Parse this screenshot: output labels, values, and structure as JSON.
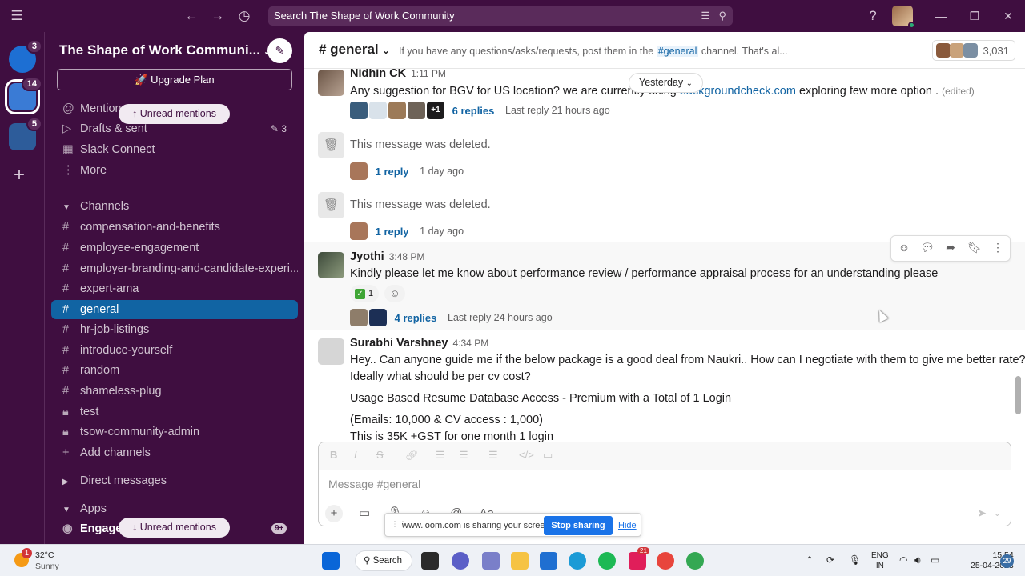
{
  "topbar": {
    "search_text": "Search The Shape of Work Community"
  },
  "rail": {
    "workspaces": [
      {
        "badge": "3",
        "color": "#1d6fd3"
      },
      {
        "badge": "14",
        "color": "#3a7bd5"
      },
      {
        "badge": "5",
        "color": "#3a6fb0"
      }
    ]
  },
  "sidebar": {
    "workspace_name": "The Shape of Work Communi...",
    "upgrade_label": "Upgrade Plan",
    "mentions_label": "Mentions",
    "unread_mentions_label": "Unread mentions",
    "drafts_label": "Drafts & sent",
    "drafts_count": "3",
    "slack_connect_label": "Slack Connect",
    "more_label": "More",
    "channels_header": "Channels",
    "channels": [
      {
        "name": "compensation-and-benefits",
        "icon": "#"
      },
      {
        "name": "employee-engagement",
        "icon": "#"
      },
      {
        "name": "employer-branding-and-candidate-experi...",
        "icon": "#"
      },
      {
        "name": "expert-ama",
        "icon": "#"
      },
      {
        "name": "general",
        "icon": "#"
      },
      {
        "name": "hr-job-listings",
        "icon": "#"
      },
      {
        "name": "introduce-yourself",
        "icon": "#"
      },
      {
        "name": "random",
        "icon": "#"
      },
      {
        "name": "shameless-plug",
        "icon": "#"
      },
      {
        "name": "test",
        "icon": "lock"
      },
      {
        "name": "tsow-community-admin",
        "icon": "lock"
      }
    ],
    "add_channels_label": "Add channels",
    "direct_messages_header": "Direct messages",
    "apps_header": "Apps",
    "app_item_label": "EngageW",
    "app_badge": "9+"
  },
  "channel": {
    "name": "# general",
    "topic_prefix": "If you have any questions/asks/requests, post them in the",
    "topic_link": "#general",
    "topic_suffix": "channel. That's al...",
    "member_count": "3,031"
  },
  "divider_label": "Yesterday",
  "messages": [
    {
      "author": "Nidhin CK",
      "time": "1:11 PM",
      "text_a": "Any suggestion for BGV for US location? we are currently using",
      "text_b": "backgroundcheck.com",
      "text_c": "exploring few more option .",
      "edited": "(edited)",
      "more_count": "+1",
      "replies": "6 replies",
      "last_reply": "Last reply 21 hours ago"
    },
    {
      "text": "This message was deleted.",
      "replies": "1 reply",
      "last_reply": "1 day ago"
    },
    {
      "text": "This message was deleted.",
      "replies": "1 reply",
      "last_reply": "1 day ago"
    },
    {
      "author": "Jyothi",
      "time": "3:48 PM",
      "text": "Kindly please let me know about performance review / performance appraisal process for an understanding please",
      "reaction_count": "1",
      "replies": "4 replies",
      "last_reply": "Last reply 24 hours ago"
    },
    {
      "author": "Surabhi Varshney",
      "time": "4:34 PM",
      "line1": "Hey.. Can anyone guide me if the below package is a good deal from Naukri.. How can I negotiate with them to give me better rate?",
      "line2": "Ideally what should be per cv cost?",
      "line3": "Usage Based Resume Database Access - Premium  with a Total of 1 Login",
      "line4": "(Emails: 10,000 & CV access : 1,000)",
      "line5": "This is 35K +GST for one month 1 login"
    }
  ],
  "composer": {
    "placeholder": "Message #general"
  },
  "screen_share": {
    "message": "www.loom.com is sharing your screen.",
    "stop_label": "Stop sharing",
    "hide_label": "Hide"
  },
  "taskbar": {
    "weather_badge": "1",
    "temperature": "32°C",
    "condition": "Sunny",
    "search_label": "Search",
    "slack_badge": "21",
    "lang_1": "ENG",
    "lang_2": "IN",
    "time": "15:54",
    "date": "25-04-2023",
    "notifications": "29"
  }
}
